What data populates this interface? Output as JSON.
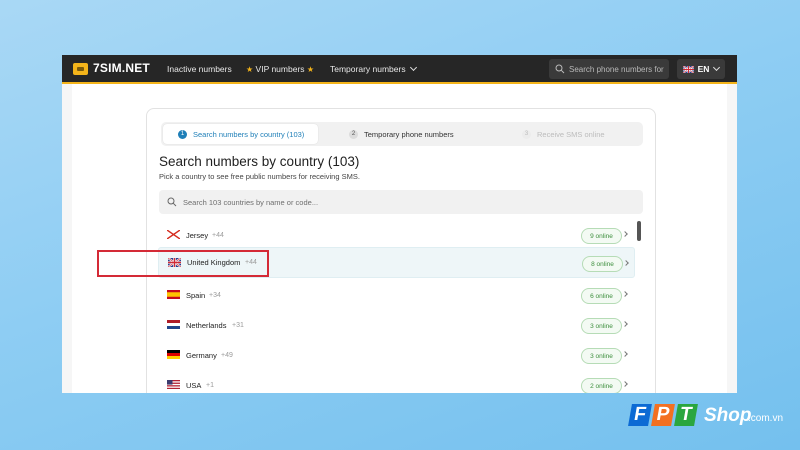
{
  "header": {
    "logo": "7SIM.NET",
    "nav": [
      {
        "label": "Inactive numbers"
      },
      {
        "label": "VIP numbers",
        "star": "★"
      },
      {
        "label": "Temporary numbers"
      }
    ],
    "search_placeholder": "Search phone numbers for",
    "language": "EN"
  },
  "steps": [
    {
      "num": "1",
      "label": "Search numbers by country (103)",
      "state": "active"
    },
    {
      "num": "2",
      "label": "Temporary phone numbers",
      "state": "normal"
    },
    {
      "num": "3",
      "label": "Receive SMS online",
      "state": "disabled"
    }
  ],
  "main": {
    "title": "Search numbers by country (103)",
    "subtitle": "Pick a country to see free public numbers for receiving SMS.",
    "search_placeholder": "Search 103 countries by name or code..."
  },
  "countries": [
    {
      "name": "Jersey",
      "code": "+44",
      "status": "9 online",
      "flag": "jersey-flag-icon"
    },
    {
      "name": "United Kingdom",
      "code": "+44",
      "status": "8 online",
      "flag": "uk-flag-icon"
    },
    {
      "name": "Spain",
      "code": "+34",
      "status": "6 online",
      "flag": "spain-flag-icon"
    },
    {
      "name": "Netherlands",
      "code": "+31",
      "status": "3 online",
      "flag": "netherlands-flag-icon"
    },
    {
      "name": "Germany",
      "code": "+49",
      "status": "3 online",
      "flag": "germany-flag-icon"
    },
    {
      "name": "USA",
      "code": "+1",
      "status": "2 online",
      "flag": "usa-flag-icon"
    }
  ],
  "watermark": {
    "letters": [
      "F",
      "P",
      "T"
    ],
    "shop": "Shop",
    "domain": ".com.vn",
    "colors": [
      "#0c6ad4",
      "#f37021",
      "#2aa63f"
    ]
  },
  "colors": {
    "accent": "#1f7fb8",
    "brand_yellow": "#f4b41a",
    "online_green": "#3c8e3c",
    "highlight_red": "#d42a36"
  }
}
